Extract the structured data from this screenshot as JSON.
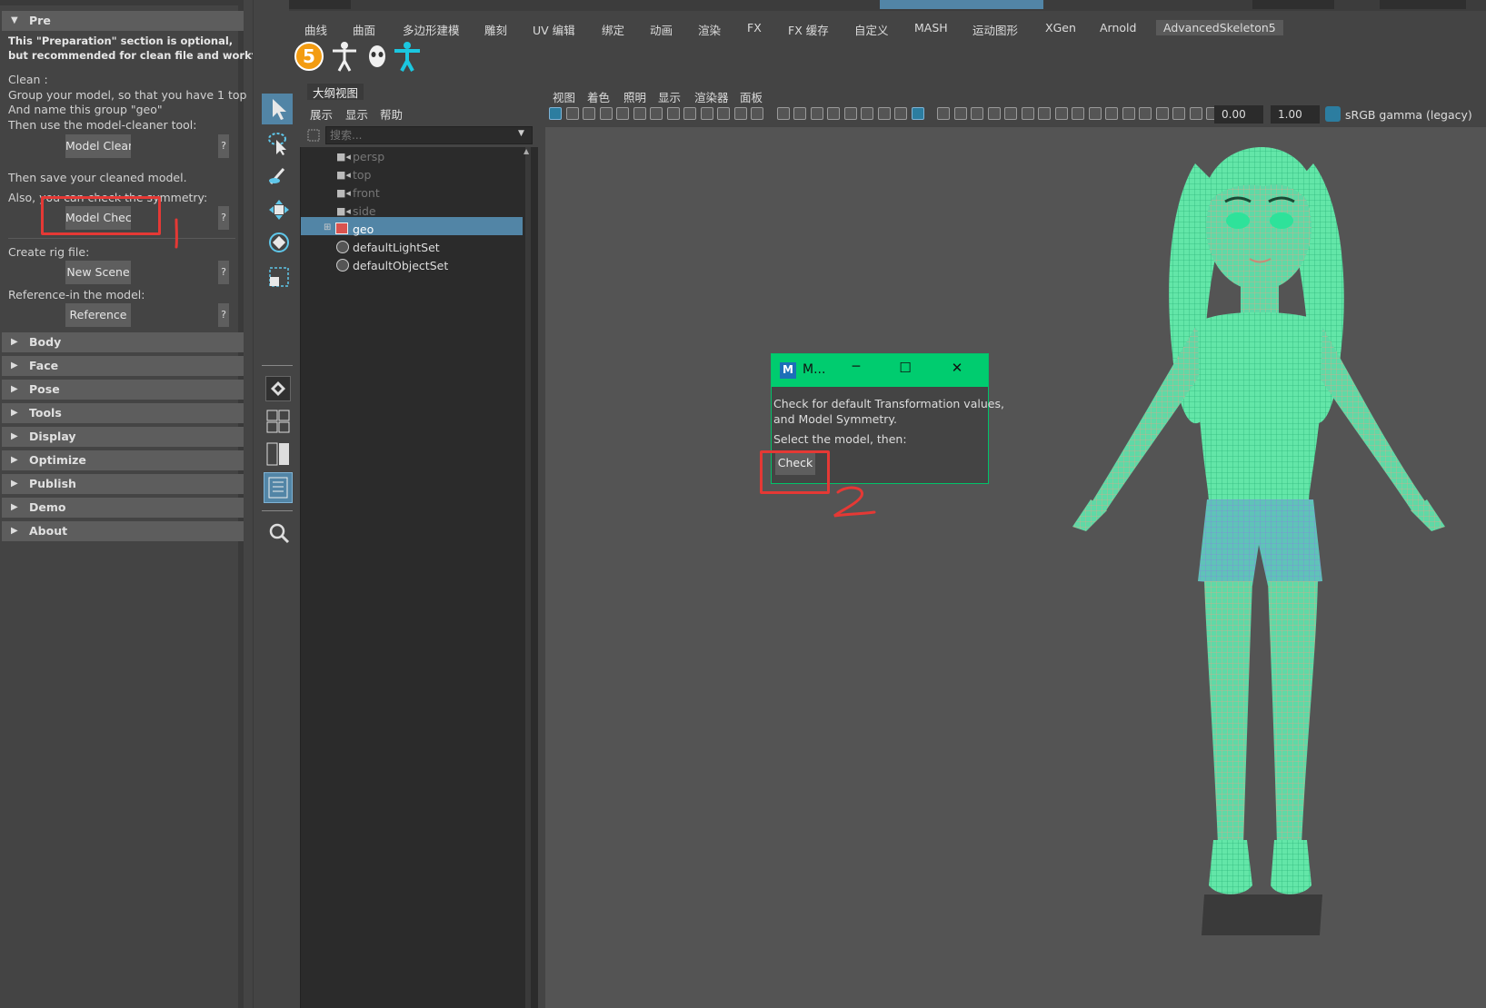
{
  "left_panel": {
    "pre_header": "Pre",
    "intro_line1": "This \"Preparation\" section is optional,",
    "intro_line2": "but recommended for clean file and workflow",
    "clean_label": "Clean :",
    "clean_line1": "Group your model, so that you have 1 top",
    "clean_line2": "And name this group \"geo\"",
    "clean_line3": "Then use the model-cleaner tool:",
    "model_clean_button": "Model Clean",
    "save_text": "Then save your cleaned model.",
    "symmetry_text": "Also, you can check the symmetry:",
    "model_check_button": "Model Check",
    "create_rig_text": "Create rig file:",
    "new_scene_button": "New Scene",
    "reference_text": "Reference-in the model:",
    "reference_button": "Reference",
    "help_button": "?",
    "sections": [
      "Body",
      "Face",
      "Pose",
      "Tools",
      "Display",
      "Optimize",
      "Publish",
      "Demo",
      "About"
    ]
  },
  "shelf_tabs": [
    "曲线",
    "曲面",
    "多边形建模",
    "雕刻",
    "UV 编辑",
    "绑定",
    "动画",
    "渲染",
    "FX",
    "FX 缓存",
    "自定义",
    "MASH",
    "运动图形",
    "XGen",
    "Arnold",
    "AdvancedSkeleton5"
  ],
  "shelf_badge": "5",
  "outliner": {
    "title": "大纲视图",
    "menus": [
      "展示",
      "显示",
      "帮助"
    ],
    "search_placeholder": "搜索...",
    "items": [
      "persp",
      "top",
      "front",
      "side",
      "geo",
      "defaultLightSet",
      "defaultObjectSet"
    ]
  },
  "viewport": {
    "menus": [
      "视图",
      "着色",
      "照明",
      "显示",
      "渲染器",
      "面板"
    ],
    "field1": "0.00",
    "field2": "1.00",
    "color_space": "sRGB gamma (legacy)"
  },
  "dialog": {
    "title": "M...",
    "app_icon": "M",
    "line1": "Check for default Transformation values,",
    "line2": "and Model Symmetry.",
    "line3": "Select the model, then:",
    "check_button": "Check",
    "minimize": "─",
    "maximize": "☐",
    "close": "✕"
  },
  "annotations": [
    "1",
    "2"
  ],
  "colors": {
    "selection_blue": "#5285a6",
    "dialog_green": "#00cc6f",
    "annotation_red": "#e53935",
    "mesh_green": "#4fe8a5"
  }
}
